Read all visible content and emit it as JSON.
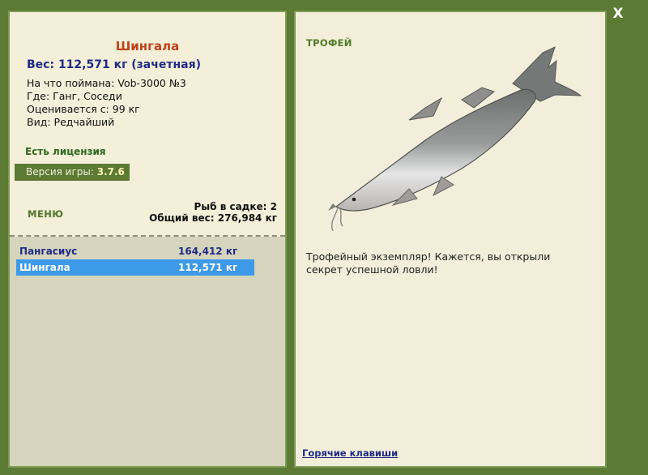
{
  "close_label": "X",
  "fish": {
    "title": "Шингала",
    "weight_line": "Вес: 112,571 кг (зачетная)",
    "caught_with": "На что поймана: Vob-3000 №3",
    "location": "Где: Ганг, Соседи",
    "valued_from": "Оценивается с: 99 кг",
    "kind": "Вид: Редчайший"
  },
  "license": "Есть лицензия",
  "version": {
    "label": "Версия игры:",
    "value": "3.7.6"
  },
  "menu_label": "МЕНЮ",
  "keepnet": {
    "count_line": "Рыб в садке: 2",
    "total_line": "Общий вес: 276,984 кг"
  },
  "catch_list": [
    {
      "name": "Пангасиус",
      "weight": "164,412 кг",
      "selected": false
    },
    {
      "name": "Шингала",
      "weight": "112,571 кг",
      "selected": true
    }
  ],
  "trophy": {
    "label": "ТРОФЕЙ",
    "text": "Трофейный экземпляр! Кажется, вы открыли секрет успешной ловли!"
  },
  "hotkeys_label": "Горячие клавиши",
  "colors": {
    "frame": "#5b7a33",
    "panel": "#f2eed9",
    "title_accent": "#c1431a",
    "link_blue": "#1f2b86",
    "selection": "#3d9ae8"
  }
}
